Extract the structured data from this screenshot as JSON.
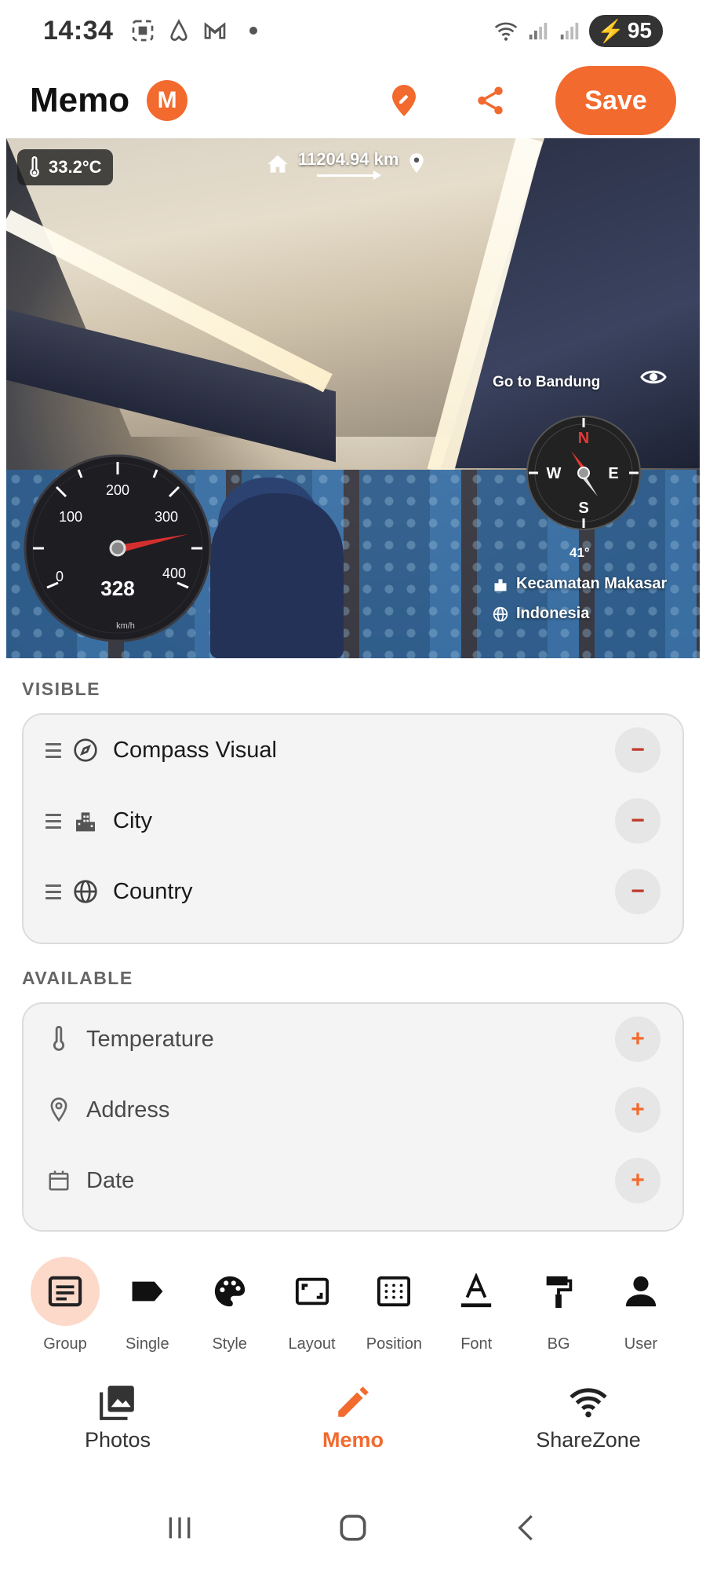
{
  "status_bar": {
    "time": "14:34",
    "battery": "95"
  },
  "header": {
    "title": "Memo",
    "avatar_letter": "M",
    "save_label": "Save"
  },
  "photo": {
    "temperature": "33.2°C",
    "distance": "11204.94 km",
    "goto_label": "Go to Bandung",
    "compass": {
      "n": "N",
      "e": "E",
      "s": "S",
      "w": "W",
      "heading": "41°"
    },
    "city": "Kecamatan Makasar",
    "country": "Indonesia",
    "speedometer": {
      "value": "328",
      "unit": "km/h",
      "ticks": [
        "0",
        "100",
        "200",
        "300",
        "400"
      ]
    }
  },
  "visible": {
    "label": "VISIBLE",
    "items": [
      {
        "label": "Compass Visual",
        "icon": "compass-icon"
      },
      {
        "label": "City",
        "icon": "city-icon"
      },
      {
        "label": "Country",
        "icon": "globe-icon"
      }
    ]
  },
  "available": {
    "label": "AVAILABLE",
    "items": [
      {
        "label": "Temperature",
        "icon": "thermometer-icon"
      },
      {
        "label": "Address",
        "icon": "location-pin-icon"
      },
      {
        "label": "Date",
        "icon": "calendar-icon"
      }
    ]
  },
  "tools": [
    {
      "label": "Group",
      "icon": "group-icon",
      "active": true
    },
    {
      "label": "Single",
      "icon": "tag-icon"
    },
    {
      "label": "Style",
      "icon": "palette-icon"
    },
    {
      "label": "Layout",
      "icon": "layout-icon"
    },
    {
      "label": "Position",
      "icon": "position-icon"
    },
    {
      "label": "Font",
      "icon": "font-icon"
    },
    {
      "label": "BG",
      "icon": "paint-roller-icon"
    },
    {
      "label": "User",
      "icon": "user-icon"
    }
  ],
  "bottom_nav": [
    {
      "label": "Photos",
      "icon": "photos-icon"
    },
    {
      "label": "Memo",
      "icon": "pencil-icon",
      "active": true
    },
    {
      "label": "ShareZone",
      "icon": "wifi-icon"
    }
  ],
  "colors": {
    "accent": "#f26a2e",
    "minus": "#c0392b",
    "panel": "#f4f4f4"
  }
}
